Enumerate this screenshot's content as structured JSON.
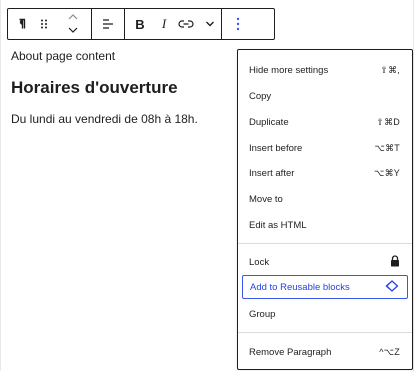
{
  "toolbar": {
    "buttons": [
      {
        "icon": "paragraph-icon"
      },
      {
        "icon": "drag-handle-icon"
      },
      {
        "icon": "move-up-down-icon"
      },
      {
        "icon": "align-icon"
      },
      {
        "icon": "bold-icon",
        "label": "B"
      },
      {
        "icon": "italic-icon",
        "label": "I"
      },
      {
        "icon": "link-icon"
      },
      {
        "icon": "chevron-down-icon"
      },
      {
        "icon": "more-options-icon"
      }
    ]
  },
  "editor": {
    "content_label": "About page content",
    "heading": "Horaires d'ouverture",
    "paragraph": "Du lundi au vendredi de 08h à 18h."
  },
  "menu": {
    "section1": [
      {
        "label": "Hide more settings",
        "shortcut": "⇧⌘,"
      },
      {
        "label": "Copy",
        "shortcut": ""
      },
      {
        "label": "Duplicate",
        "shortcut": "⇧⌘D"
      },
      {
        "label": "Insert before",
        "shortcut": "⌥⌘T"
      },
      {
        "label": "Insert after",
        "shortcut": "⌥⌘Y"
      },
      {
        "label": "Move to",
        "shortcut": ""
      },
      {
        "label": "Edit as HTML",
        "shortcut": ""
      }
    ],
    "section2": [
      {
        "label": "Lock",
        "icon": "lock-icon"
      },
      {
        "label": "Add to Reusable blocks",
        "icon": "reusable-block-icon"
      },
      {
        "label": "Group"
      }
    ],
    "section3": [
      {
        "label": "Remove Paragraph",
        "shortcut": "^⌥Z"
      }
    ]
  },
  "colors": {
    "accent": "#3858e9",
    "text": "#1e1e1e"
  }
}
